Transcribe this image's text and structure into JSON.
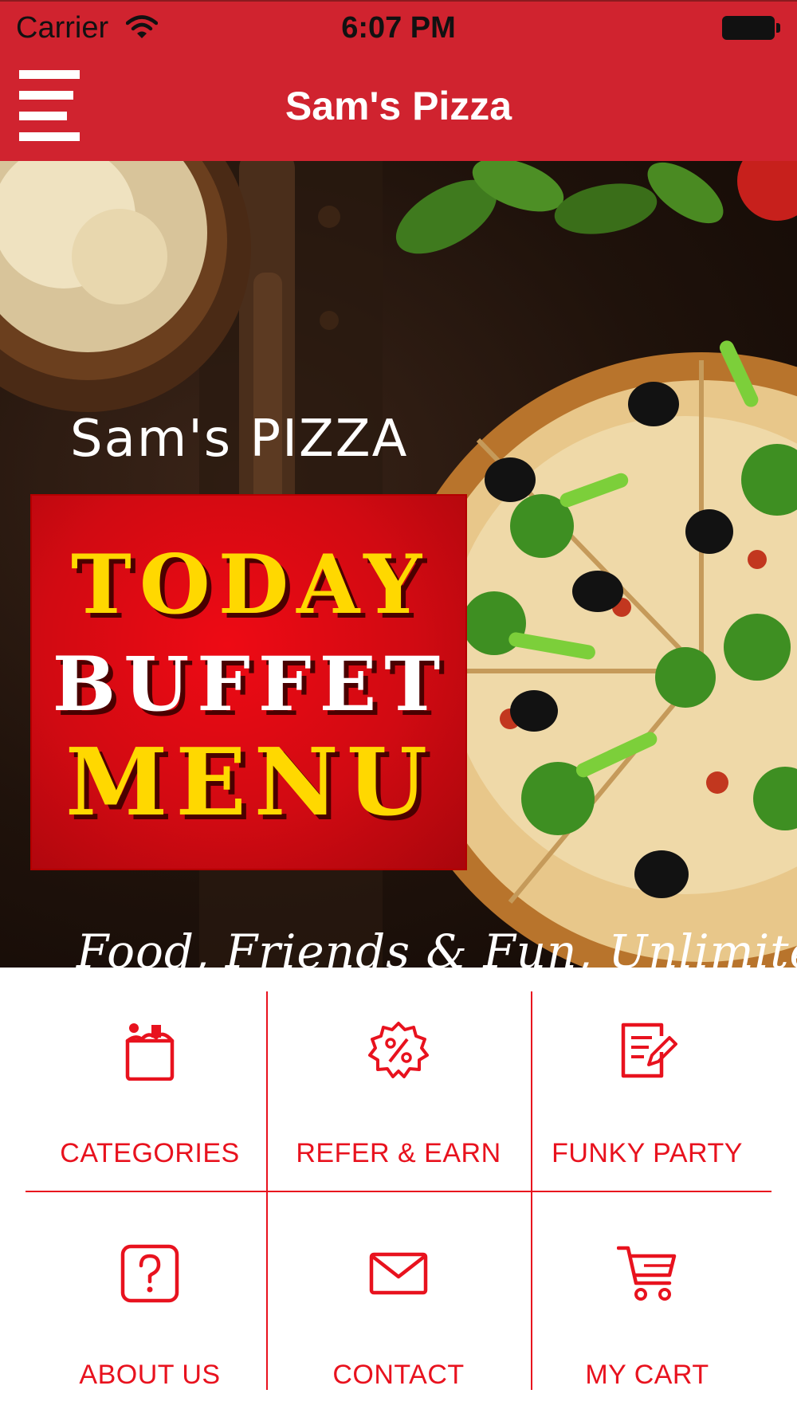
{
  "status_bar": {
    "carrier": "Carrier",
    "time": "6:07 PM"
  },
  "header": {
    "title": "Sam's Pizza",
    "menu_icon": "hamburger-menu-icon"
  },
  "banner": {
    "brand": "Sam's PIZZA",
    "promo_line_1": "TODAY",
    "promo_line_2": "BUFFET",
    "promo_line_3": "MENU",
    "tagline": "Food, Friends & Fun, Unlimited"
  },
  "colors": {
    "header_bg": "#d0232f",
    "accent": "#e8121e",
    "promo_yellow": "#ffd800"
  },
  "menu": {
    "items": [
      {
        "label": "CATEGORIES",
        "icon": "grocery-bag-icon"
      },
      {
        "label": "REFER & EARN",
        "icon": "discount-badge-icon"
      },
      {
        "label": "FUNKY PARTY",
        "icon": "edit-document-icon"
      },
      {
        "label": "ABOUT US",
        "icon": "question-icon"
      },
      {
        "label": "CONTACT",
        "icon": "envelope-icon"
      },
      {
        "label": "MY CART",
        "icon": "cart-icon"
      }
    ]
  }
}
